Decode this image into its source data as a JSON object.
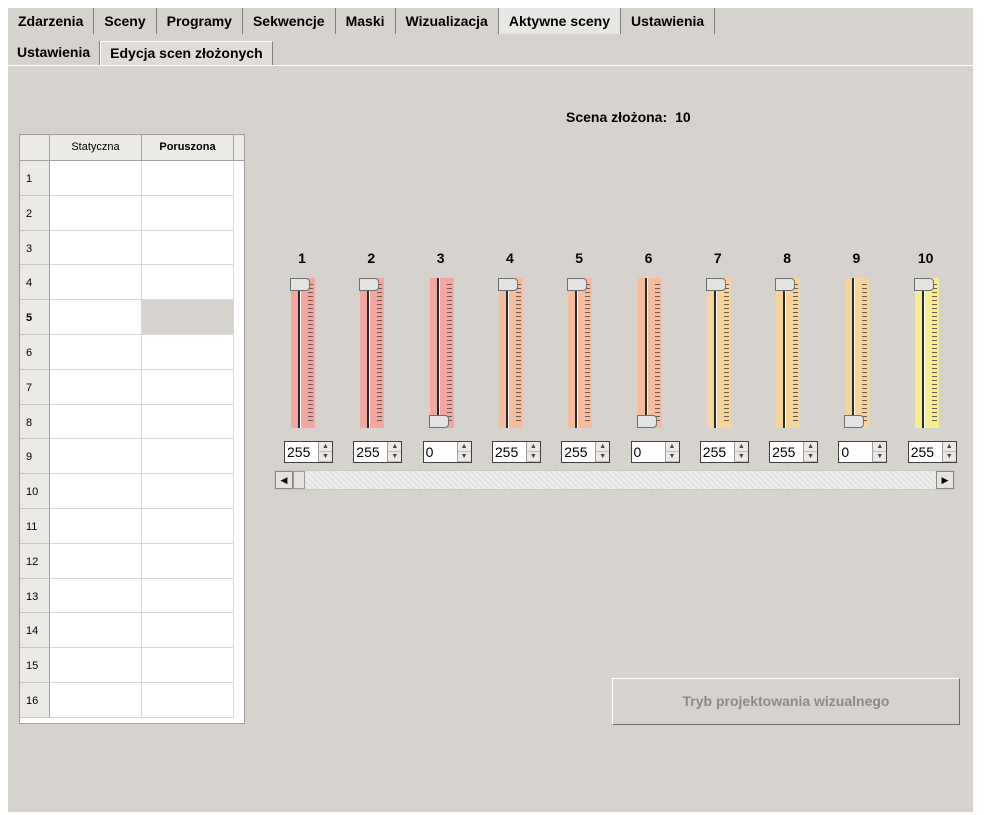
{
  "tabs_main": [
    "Zdarzenia",
    "Sceny",
    "Programy",
    "Sekwencje",
    "Maski",
    "Wizualizacja",
    "Aktywne sceny",
    "Ustawienia"
  ],
  "tabs_main_active": "Aktywne sceny",
  "tabs_sub": [
    "Ustawienia",
    "Edycja scen złożonych"
  ],
  "tabs_sub_active": "Edycja scen złożonych",
  "scene": {
    "label": "Scena złożona:",
    "value": "10"
  },
  "grid": {
    "columns": [
      "Statyczna",
      "Poruszona"
    ],
    "rows": [
      "1",
      "2",
      "3",
      "4",
      "5",
      "6",
      "7",
      "8",
      "9",
      "10",
      "11",
      "12",
      "13",
      "14",
      "15",
      "16"
    ],
    "selected_row": "5"
  },
  "sliders": [
    {
      "label": "1",
      "value": "255",
      "color": "#f4a6a0"
    },
    {
      "label": "2",
      "value": "255",
      "color": "#f4a6a0"
    },
    {
      "label": "3",
      "value": "0",
      "color": "#f4a6a0"
    },
    {
      "label": "4",
      "value": "255",
      "color": "#f6bc9e"
    },
    {
      "label": "5",
      "value": "255",
      "color": "#f6bc9e"
    },
    {
      "label": "6",
      "value": "0",
      "color": "#f6bc9e"
    },
    {
      "label": "7",
      "value": "255",
      "color": "#f7d49a"
    },
    {
      "label": "8",
      "value": "255",
      "color": "#f7d49a"
    },
    {
      "label": "9",
      "value": "0",
      "color": "#f7d49a"
    },
    {
      "label": "10",
      "value": "255",
      "color": "#f6ec90"
    }
  ],
  "design_button": "Tryb projektowania wizualnego"
}
